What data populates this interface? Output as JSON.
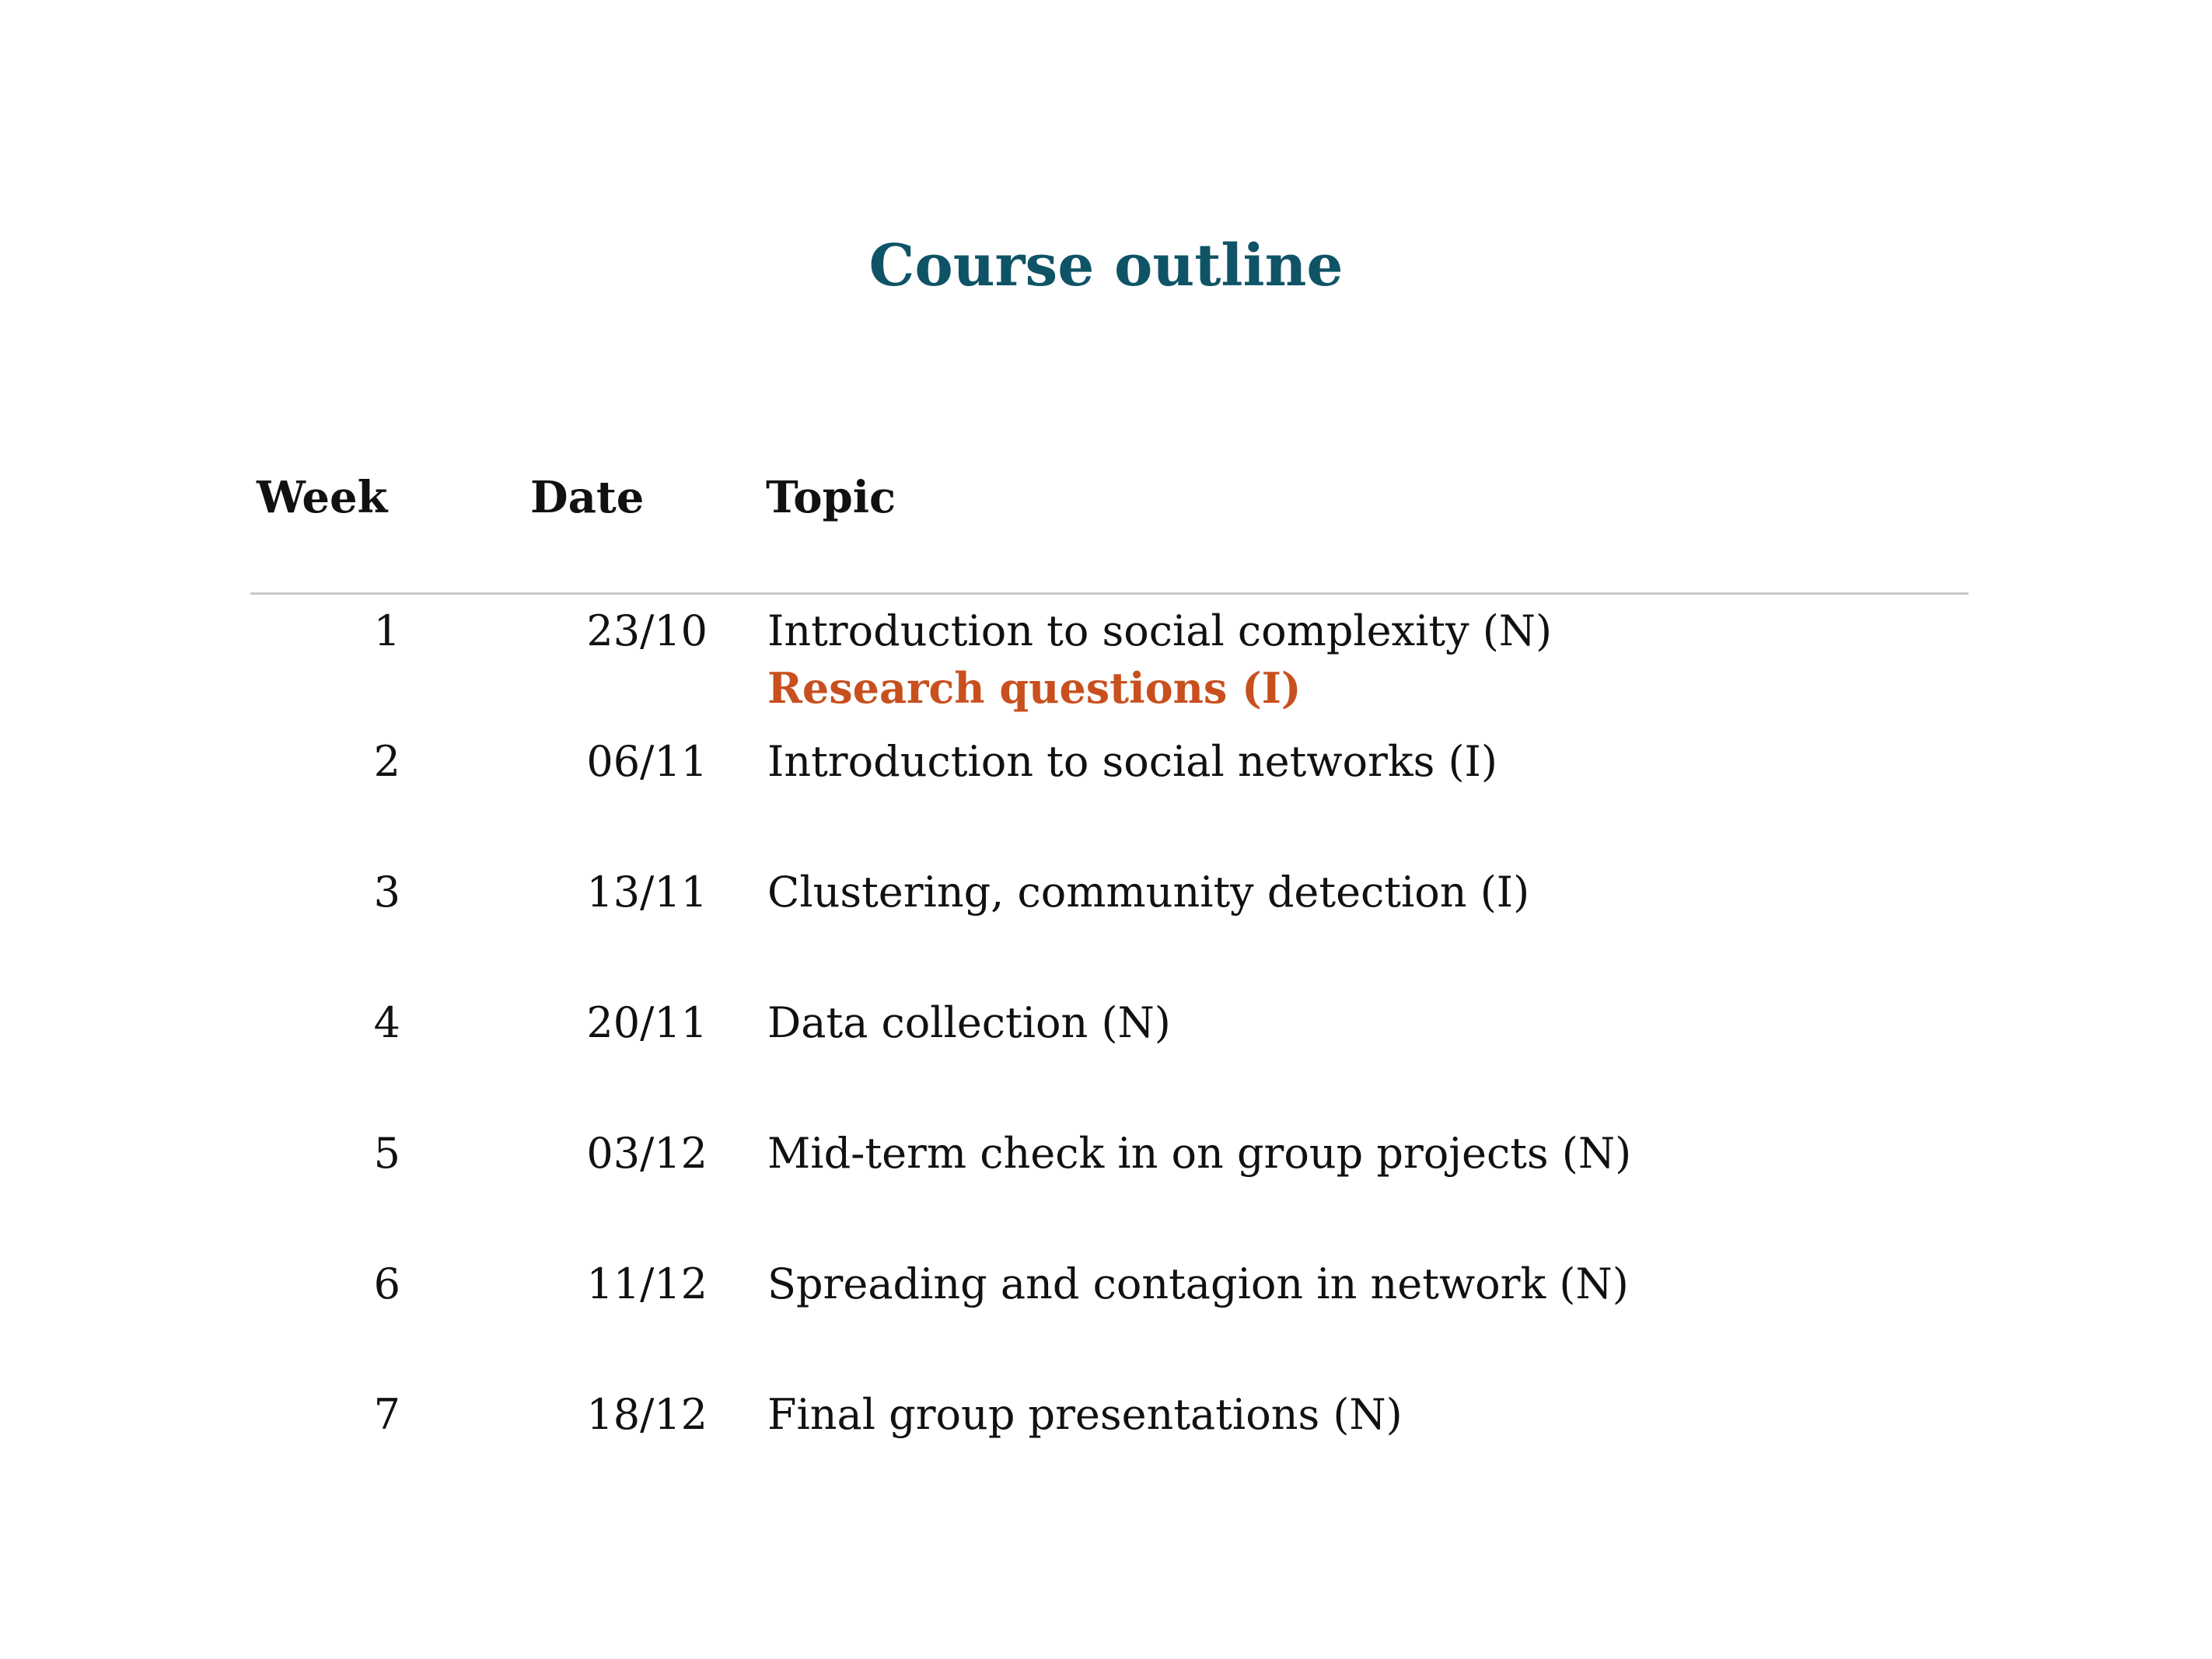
{
  "title": "Course outline",
  "columns": {
    "week": "Week",
    "date": "Date",
    "topic": "Topic"
  },
  "accent_color": "#c8501e",
  "title_color": "#0f5466",
  "rows": [
    {
      "week": "1",
      "date": "23/10",
      "topic": "Introduction to social complexity (N)",
      "extra": "Research questions (I)"
    },
    {
      "week": "2",
      "date": "06/11",
      "topic": "Introduction to social networks (I)"
    },
    {
      "week": "3",
      "date": "13/11",
      "topic": "Clustering, community detection (I)"
    },
    {
      "week": "4",
      "date": "20/11",
      "topic": "Data collection (N)"
    },
    {
      "week": "5",
      "date": "03/12",
      "topic": "Mid-term check in on group projects (N)"
    },
    {
      "week": "6",
      "date": "11/12",
      "topic": "Spreading and contagion in network (N)"
    },
    {
      "week": "7",
      "date": "18/12",
      "topic": "Final group presentations (N)"
    }
  ]
}
